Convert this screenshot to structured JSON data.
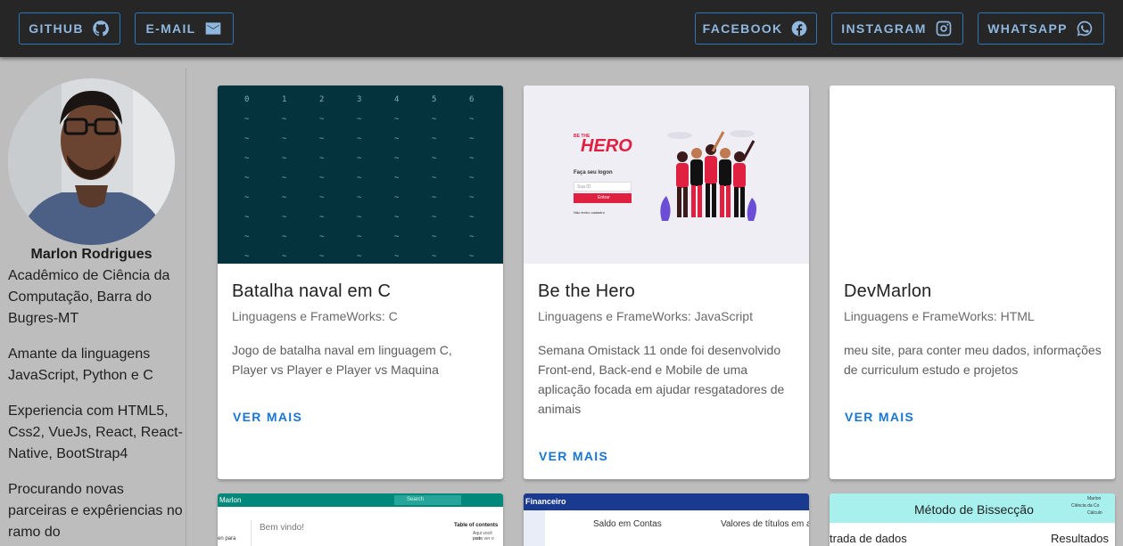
{
  "topbar": {
    "left_buttons": [
      {
        "label": "GITHUB",
        "icon": "github-icon"
      },
      {
        "label": "E-MAIL",
        "icon": "mail-icon"
      }
    ],
    "right_buttons": [
      {
        "label": "FACEBOOK",
        "icon": "facebook-icon"
      },
      {
        "label": "INSTAGRAM",
        "icon": "instagram-icon"
      },
      {
        "label": "WHATSAPP",
        "icon": "whatsapp-icon"
      }
    ],
    "accent_color": "#1976d2"
  },
  "profile": {
    "name": "Marlon Rodrigues",
    "bio": [
      "Acadêmico de Ciência da Computação, Barra do Bugres-MT",
      "Amante da linguagens JavaScript, Python e C",
      "Experiencia com HTML5, Css2, VueJs, React, React-Native, BootStrap4",
      "Procurando novas parceiras e expêriencias no ramo do"
    ]
  },
  "projects": [
    {
      "title": "Batalha naval em C",
      "subtitle": "Linguagens e FrameWorks: C",
      "description": "Jogo de batalha naval em linguagem C, Player vs Player e Player vs Maquina",
      "button": "VER MAIS",
      "preview": {
        "columns": [
          "0",
          "1",
          "2",
          "3",
          "4",
          "5",
          "6"
        ],
        "cell": "~"
      }
    },
    {
      "title": "Be the Hero",
      "subtitle": "Linguagens e FrameWorks: JavaScript",
      "description": "Semana Omistack 11 onde foi desenvolvido Front-end, Back-end e Mobile de uma aplicação focada em ajudar resgatadores de animais",
      "button": "VER MAIS",
      "preview": {
        "logo": "HERO",
        "logo_top": "BE THE",
        "login_title": "Faça seu logon",
        "input_placeholder": "Sua ID",
        "login_button": "Entrar",
        "register_link": "Não tenho cadastro"
      }
    },
    {
      "title": "DevMarlon",
      "subtitle": "Linguagens e FrameWorks: HTML",
      "description": "meu site, para conter meu dados, informações de curriculum estudo e projetos",
      "button": "VER MAIS"
    }
  ],
  "previews_row2": [
    {
      "bar_title": "Marlon",
      "search": "Search",
      "welcome": "Bem vindo!",
      "toc": "Table of contents",
      "toc_text": "Aqui você pode ver o",
      "toc_text2": "com.",
      "left_text": "en para",
      "bar_color": "#00897b"
    },
    {
      "bar_title": "Financeiro",
      "col1": "Saldo em Contas",
      "col2": "Valores de títulos em abe",
      "bar_color": "#1a3a8f"
    },
    {
      "header": "Método de Bissecção",
      "left": "trada de dados",
      "right": "Resultados",
      "corner": [
        "Marlon",
        "Ciência da Co",
        "Cálculo"
      ],
      "bar_color": "#a7f0ee"
    }
  ]
}
